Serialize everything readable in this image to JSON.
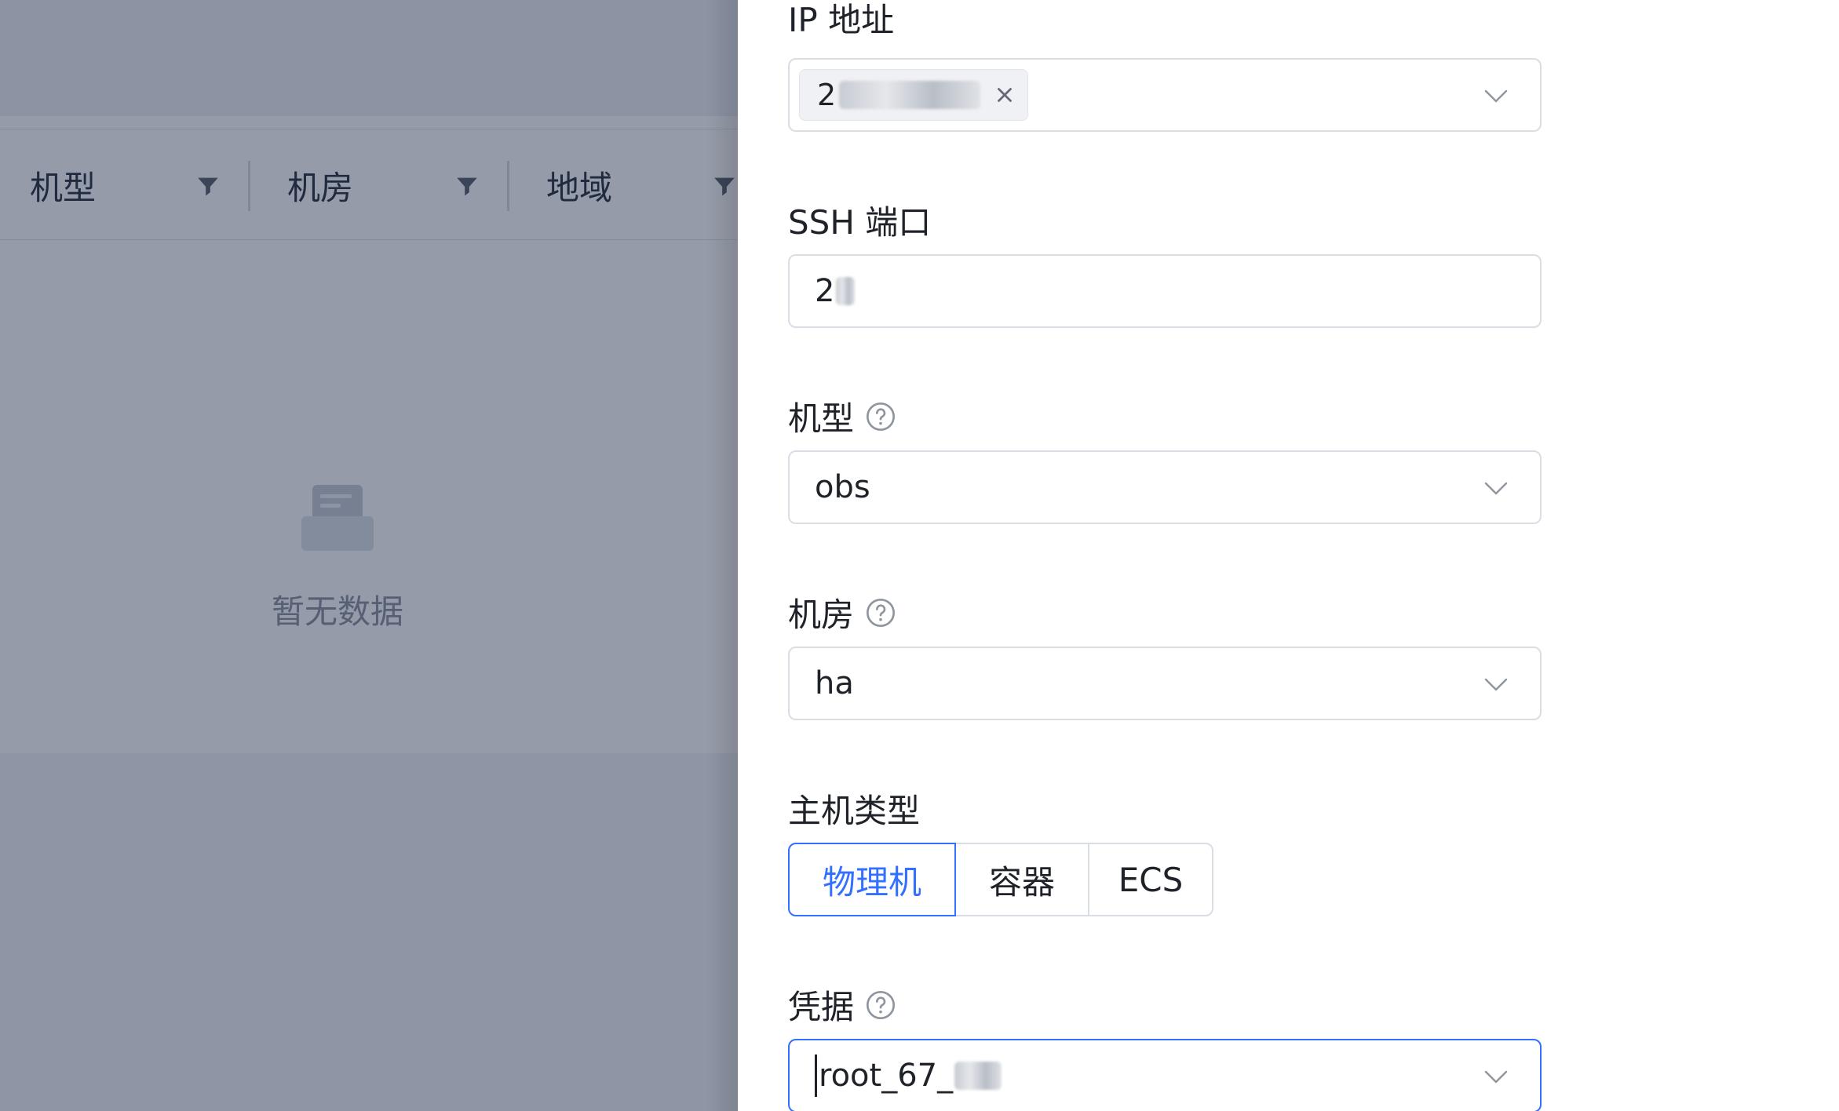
{
  "background": {
    "table_columns": [
      {
        "label": "机型"
      },
      {
        "label": "机房"
      },
      {
        "label": "地域"
      }
    ],
    "empty_text": "暂无数据"
  },
  "drawer": {
    "ip": {
      "label": "IP 地址",
      "tag_prefix": "2"
    },
    "ssh_port": {
      "label": "SSH 端口",
      "value_prefix": "2"
    },
    "machine_type": {
      "label": "机型",
      "value": "obs"
    },
    "idc": {
      "label": "机房",
      "value": "ha"
    },
    "host_type": {
      "label": "主机类型",
      "options": [
        "物理机",
        "容器",
        "ECS"
      ],
      "selected": "物理机"
    },
    "credential": {
      "label": "凭据",
      "value_prefix": "root_67_"
    }
  },
  "colors": {
    "accent": "#3370ff",
    "border": "#d9dde4",
    "text": "#1f2329",
    "mask": "rgba(21,33,62,0.45)"
  }
}
